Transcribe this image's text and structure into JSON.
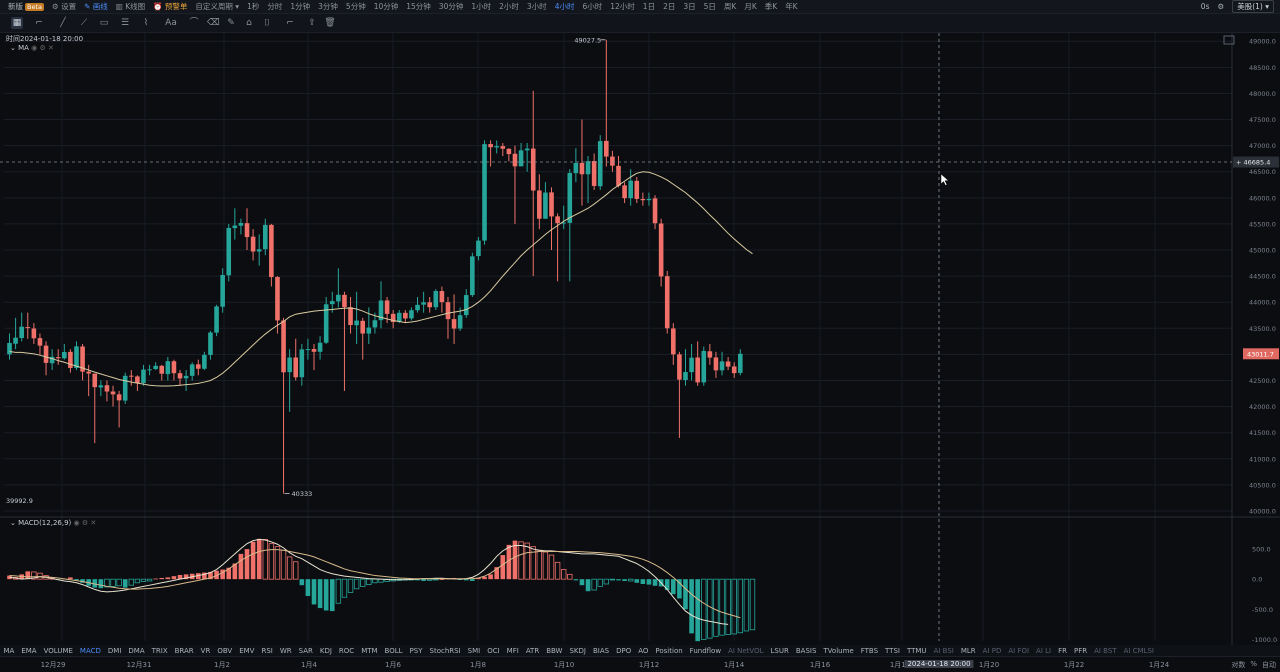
{
  "topbar": {
    "brand": "新版",
    "brand_badge": "Beta",
    "settings": "设置",
    "draw": "画线",
    "chart_type": "K线图",
    "alert": "预警单",
    "custom_period": "自定义周期",
    "periods": [
      "1秒",
      "分时",
      "1分钟",
      "3分钟",
      "5分钟",
      "10分钟",
      "15分钟",
      "30分钟",
      "1小时",
      "2小时",
      "3小时",
      "4小时",
      "6小时",
      "12小时",
      "1日",
      "2日",
      "3日",
      "5日",
      "周K",
      "月K",
      "季K",
      "年K"
    ],
    "active_period": "4小时",
    "right_text": "0s",
    "currency_select": "美股(1)"
  },
  "toolbar": {
    "tools": [
      "crosshair-icon",
      "line-icon",
      "ray-icon",
      "trend-icon",
      "rect-icon",
      "fib-icon",
      "brush-icon",
      "text-icon",
      "measure-icon",
      "erase-icon",
      "pencil-icon",
      "magnet-icon",
      "lock-icon",
      "eye-icon",
      "share-icon",
      "trash-icon"
    ]
  },
  "info": {
    "time_label": "时间2024-01-18 20:00",
    "ma_label": "MA",
    "macd_label": "MACD(12,26,9)"
  },
  "annotations": {
    "high": "49027.5",
    "low": "40333",
    "bottom_left": "39992.9",
    "crosshair_price": "46685.4",
    "last_price": "43011.7"
  },
  "colors": {
    "up": "#26a69a",
    "down": "#ef7169",
    "ma": "#d9cba0",
    "macd_line": "#e8e2cf",
    "signal_line": "#d8b98a",
    "last_price_bg": "#e06a62"
  },
  "chart_data": {
    "type": "candlestick",
    "interval": "4小时",
    "ylim": [
      40000,
      49100
    ],
    "y_ticks": [
      "49000.0",
      "48500.0",
      "48000.0",
      "47500.0",
      "47000.0",
      "46500.0",
      "46000.0",
      "45500.0",
      "45000.0",
      "44500.0",
      "44000.0",
      "43500.0",
      "43000.0",
      "42500.0",
      "42000.0",
      "41500.0",
      "41000.0",
      "40500.0",
      "40000.0"
    ],
    "x_ticks": [
      "12月29",
      "12月31",
      "1月2",
      "1月4",
      "1月6",
      "1月8",
      "1月10",
      "1月12",
      "1月14",
      "1月16",
      "1月18",
      "2024-01-18 20:00",
      "1月20",
      "1月22",
      "1月24"
    ],
    "candles": [
      [
        43001,
        43219,
        42900,
        43400
      ],
      [
        43204,
        43320,
        43100,
        43700
      ],
      [
        43314,
        43531,
        43250,
        43800
      ],
      [
        43524,
        43504,
        43300,
        43800
      ],
      [
        43496,
        43308,
        43200,
        43600
      ],
      [
        43312,
        43168,
        43000,
        43400
      ],
      [
        43168,
        42837,
        42600,
        43250
      ],
      [
        42831,
        42954,
        42700,
        43100
      ],
      [
        42948,
        42926,
        42800,
        43100
      ],
      [
        42926,
        43046,
        42900,
        43200
      ],
      [
        43049,
        42740,
        42650,
        43100
      ],
      [
        42740,
        43154,
        42700,
        43250
      ],
      [
        43152,
        42670,
        42500,
        43200
      ],
      [
        42671,
        42633,
        42200,
        42800
      ],
      [
        42633,
        42373,
        41300,
        42500
      ],
      [
        42367,
        42409,
        42200,
        42500
      ],
      [
        42409,
        42289,
        42100,
        42500
      ],
      [
        42289,
        42235,
        42000,
        42400
      ],
      [
        42235,
        42120,
        41600,
        42300
      ],
      [
        42115,
        42590,
        42050,
        42650
      ],
      [
        42592,
        42576,
        42400,
        42700
      ],
      [
        42578,
        42452,
        42300,
        42600
      ],
      [
        42452,
        42709,
        42400,
        42800
      ],
      [
        42709,
        42714,
        42600,
        42800
      ],
      [
        42720,
        42781,
        42700,
        42850
      ],
      [
        42781,
        42630,
        42500,
        42800
      ],
      [
        42623,
        42870,
        42500,
        42950
      ],
      [
        42870,
        42640,
        42500,
        42900
      ],
      [
        42640,
        42539,
        42400,
        42700
      ],
      [
        42541,
        42589,
        42300,
        42700
      ],
      [
        42589,
        42808,
        42500,
        42850
      ],
      [
        42810,
        42725,
        42600,
        42900
      ],
      [
        42725,
        42991,
        42700,
        43050
      ],
      [
        42990,
        43419,
        42900,
        43450
      ],
      [
        43417,
        43919,
        43350,
        43950
      ],
      [
        43913,
        44521,
        43800,
        44650
      ],
      [
        44516,
        45423,
        44400,
        45500
      ],
      [
        45419,
        45469,
        45200,
        45800
      ],
      [
        45465,
        45518,
        45300,
        45600
      ],
      [
        45514,
        45248,
        45000,
        45800
      ],
      [
        45256,
        44971,
        44800,
        45400
      ],
      [
        44971,
        45014,
        44700,
        45300
      ],
      [
        45017,
        45481,
        44900,
        45600
      ],
      [
        45482,
        44481,
        44300,
        45500
      ],
      [
        44483,
        43651,
        43400,
        44500
      ],
      [
        43650,
        42657,
        40333,
        43700
      ],
      [
        42660,
        42940,
        41900,
        43100
      ],
      [
        42941,
        42562,
        42500,
        43300
      ],
      [
        42563,
        43096,
        42400,
        43200
      ],
      [
        43092,
        43102,
        42900,
        43300
      ],
      [
        43103,
        43050,
        42700,
        43200
      ],
      [
        43050,
        43223,
        42900,
        43350
      ],
      [
        43224,
        43960,
        43200,
        44100
      ],
      [
        43963,
        44021,
        43800,
        44200
      ],
      [
        44016,
        44142,
        43900,
        44650
      ],
      [
        44141,
        43905,
        42300,
        44200
      ],
      [
        43905,
        43563,
        43400,
        44100
      ],
      [
        43559,
        43648,
        43200,
        44200
      ],
      [
        43643,
        43400,
        42900,
        43700
      ],
      [
        43399,
        43514,
        43200,
        43900
      ],
      [
        43517,
        43654,
        43400,
        43800
      ],
      [
        43656,
        44033,
        43500,
        44400
      ],
      [
        44034,
        43776,
        43600,
        44100
      ],
      [
        43777,
        43619,
        43500,
        43850
      ],
      [
        43622,
        43797,
        43600,
        43850
      ],
      [
        43797,
        43689,
        43600,
        43850
      ],
      [
        43690,
        43846,
        43650,
        43900
      ],
      [
        43846,
        43949,
        43800,
        44100
      ],
      [
        43953,
        43998,
        43800,
        44200
      ],
      [
        43998,
        43904,
        43800,
        44100
      ],
      [
        43904,
        44214,
        43850,
        44250
      ],
      [
        44214,
        44002,
        43800,
        44300
      ],
      [
        44000,
        43676,
        43300,
        44100
      ],
      [
        43676,
        43495,
        43200,
        44150
      ],
      [
        43495,
        43751,
        43450,
        43900
      ],
      [
        43753,
        44137,
        43700,
        44250
      ],
      [
        44137,
        44878,
        44100,
        44950
      ],
      [
        44883,
        45180,
        44800,
        45250
      ],
      [
        45180,
        47028,
        45100,
        47100
      ],
      [
        47030,
        46969,
        46600,
        47100
      ],
      [
        46965,
        46990,
        46850,
        47100
      ],
      [
        46990,
        46940,
        46800,
        47050
      ],
      [
        46939,
        46838,
        46700,
        46950
      ],
      [
        46844,
        46603,
        45500,
        47000
      ],
      [
        46603,
        46910,
        46700,
        47050
      ],
      [
        46909,
        46944,
        46500,
        47050
      ],
      [
        46944,
        46139,
        44500,
        48050
      ],
      [
        46141,
        45599,
        45400,
        46450
      ],
      [
        45599,
        46101,
        45600,
        46300
      ],
      [
        46104,
        45643,
        45000,
        46200
      ],
      [
        45645,
        45514,
        44400,
        45700
      ],
      [
        45508,
        45526,
        45400,
        45850
      ],
      [
        45520,
        46475,
        44400,
        46550
      ],
      [
        46472,
        46667,
        46300,
        46950
      ],
      [
        46667,
        46451,
        45850,
        47500
      ],
      [
        46451,
        46702,
        45900,
        46800
      ],
      [
        46705,
        46227,
        46150,
        46850
      ],
      [
        46222,
        47086,
        46150,
        47200
      ],
      [
        47090,
        46790,
        46600,
        49027.5
      ],
      [
        46790,
        46615,
        46500,
        46900
      ],
      [
        46612,
        46231,
        46200,
        46800
      ],
      [
        46239,
        45993,
        45900,
        46300
      ],
      [
        45993,
        46328,
        45850,
        46550
      ],
      [
        46325,
        45979,
        45900,
        46400
      ],
      [
        45978,
        45954,
        45850,
        46100
      ],
      [
        45955,
        45980,
        45850,
        46100
      ],
      [
        45990,
        45513,
        45400,
        46050
      ],
      [
        45508,
        44493,
        44300,
        45600
      ],
      [
        44499,
        43501,
        43400,
        44600
      ],
      [
        43497,
        43001,
        42800,
        43600
      ],
      [
        43001,
        42516,
        41400,
        43050
      ],
      [
        42509,
        42662,
        42400,
        43100
      ],
      [
        42661,
        42937,
        42500,
        43200
      ],
      [
        42941,
        42464,
        42400,
        43250
      ],
      [
        42464,
        43066,
        42400,
        43150
      ],
      [
        43060,
        42939,
        42800,
        43200
      ],
      [
        42942,
        42695,
        42550,
        43050
      ],
      [
        42695,
        42866,
        42600,
        43050
      ],
      [
        42864,
        42766,
        42700,
        42950
      ],
      [
        42770,
        42641,
        42550,
        42850
      ],
      [
        42646,
        43012,
        42600,
        43100
      ]
    ],
    "ma_values": [
      43055,
      43040,
      43040,
      43025,
      43010,
      42985,
      42950,
      42920,
      42880,
      42850,
      42810,
      42775,
      42740,
      42700,
      42660,
      42625,
      42590,
      42555,
      42520,
      42495,
      42470,
      42450,
      42430,
      42410,
      42400,
      42395,
      42395,
      42400,
      42410,
      42420,
      42430,
      42445,
      42470,
      42500,
      42560,
      42640,
      42740,
      42850,
      42960,
      43070,
      43180,
      43290,
      43390,
      43480,
      43560,
      43630,
      43720,
      43770,
      43790,
      43810,
      43830,
      43840,
      43850,
      43860,
      43875,
      43885,
      43890,
      43870,
      43830,
      43780,
      43740,
      43710,
      43680,
      43650,
      43630,
      43610,
      43620,
      43640,
      43670,
      43700,
      43730,
      43760,
      43790,
      43810,
      43830,
      43860,
      43920,
      44000,
      44100,
      44220,
      44360,
      44500,
      44630,
      44760,
      44890,
      45000,
      45100,
      45200,
      45300,
      45390,
      45470,
      45550,
      45620,
      45680,
      45740,
      45800,
      45880,
      45970,
      46060,
      46160,
      46240,
      46320,
      46400,
      46470,
      46500,
      46490,
      46450,
      46400,
      46340,
      46260,
      46180,
      46100,
      46000,
      45900,
      45790,
      45670,
      45560,
      45440,
      45320,
      45210,
      45110,
      45010,
      44930
    ],
    "macd": {
      "ylim": [
        -1060,
        800
      ],
      "y_ticks": [
        "500.0",
        "0.0",
        "-500.0",
        "-1000.0"
      ],
      "hist": [
        60,
        30,
        80,
        130,
        120,
        100,
        60,
        20,
        -10,
        10,
        30,
        -20,
        -60,
        -110,
        -140,
        -150,
        -130,
        -120,
        -110,
        -140,
        -100,
        -60,
        -40,
        -30,
        10,
        20,
        30,
        50,
        70,
        80,
        90,
        100,
        110,
        120,
        140,
        160,
        190,
        260,
        420,
        500,
        620,
        670,
        660,
        590,
        540,
        480,
        370,
        290,
        -100,
        -280,
        -420,
        -480,
        -520,
        -530,
        -400,
        -300,
        -220,
        -160,
        -120,
        -90,
        -60,
        -50,
        -40,
        -30,
        -20,
        -10,
        -10,
        -20,
        -30,
        -20,
        -10,
        0,
        10,
        20,
        -10,
        -20,
        -30,
        20,
        40,
        80,
        200,
        400,
        570,
        640,
        620,
        600,
        540,
        480,
        450,
        400,
        280,
        160,
        80,
        -20,
        -100,
        -200,
        -180,
        -120,
        -80,
        -10,
        -20,
        -30,
        -30,
        -60,
        -80,
        -90,
        -110,
        -120,
        -180,
        -250,
        -320,
        -500,
        -900,
        -1030,
        -1000,
        -980,
        -950,
        -930,
        -920,
        -910,
        -890,
        -860,
        -840
      ],
      "macd_line": [
        30,
        20,
        0,
        10,
        20,
        40,
        30,
        10,
        -10,
        -30,
        -40,
        -60,
        -90,
        -130,
        -170,
        -200,
        -210,
        -205,
        -195,
        -180,
        -160,
        -140,
        -120,
        -100,
        -80,
        -60,
        -40,
        -20,
        0,
        20,
        40,
        60,
        80,
        110,
        160,
        240,
        330,
        420,
        510,
        590,
        640,
        660,
        650,
        620,
        580,
        520,
        440,
        380,
        340,
        280,
        220,
        160,
        120,
        90,
        70,
        50,
        40,
        30,
        20,
        10,
        5,
        0,
        -5,
        -10,
        -10,
        -10,
        -5,
        0,
        10,
        10,
        15,
        15,
        10,
        5,
        0,
        10,
        30,
        80,
        160,
        260,
        380,
        470,
        530,
        560,
        560,
        540,
        500,
        480,
        470,
        470,
        460,
        450,
        440,
        430,
        420,
        420,
        420,
        410,
        400,
        390,
        380,
        340,
        300,
        260,
        200,
        130,
        40,
        -60,
        -170,
        -300,
        -420,
        -530,
        -600,
        -650,
        -680,
        -700,
        -720,
        -740,
        -750
      ],
      "signal_line": [
        60,
        55,
        45,
        40,
        40,
        45,
        40,
        30,
        20,
        5,
        -10,
        -25,
        -40,
        -60,
        -80,
        -100,
        -120,
        -135,
        -150,
        -160,
        -165,
        -165,
        -160,
        -155,
        -145,
        -135,
        -120,
        -100,
        -80,
        -60,
        -40,
        -20,
        0,
        20,
        60,
        110,
        170,
        240,
        310,
        370,
        420,
        460,
        480,
        490,
        490,
        480,
        460,
        440,
        420,
        400,
        370,
        330,
        290,
        250,
        210,
        170,
        140,
        120,
        100,
        80,
        60,
        50,
        40,
        30,
        20,
        15,
        10,
        8,
        6,
        6,
        8,
        8,
        8,
        8,
        6,
        6,
        10,
        20,
        50,
        100,
        170,
        240,
        310,
        370,
        410,
        440,
        450,
        460,
        460,
        460,
        460,
        460,
        460,
        460,
        455,
        450,
        445,
        440,
        430,
        420,
        410,
        395,
        380,
        360,
        330,
        290,
        240,
        180,
        110,
        30,
        -60,
        -160,
        -250,
        -330,
        -400,
        -460,
        -510,
        -550,
        -580,
        -610,
        -640
      ]
    }
  },
  "bottom_indicators": [
    "MA",
    "EMA",
    "VOLUME",
    "MACD",
    "DMI",
    "DMA",
    "TRIX",
    "BRAR",
    "VR",
    "OBV",
    "EMV",
    "RSI",
    "WR",
    "SAR",
    "KDJ",
    "ROC",
    "MTM",
    "BOLL",
    "PSY",
    "StochRSI",
    "SMI",
    "OCI",
    "MFI",
    "ATR",
    "BBW",
    "SKDJ",
    "BIAS",
    "DPO",
    "AO",
    "Position",
    "Fundflow",
    "AI NetVOL",
    "LSUR",
    "BASIS",
    "TVolume",
    "FTBS",
    "TTSI",
    "TTMU",
    "AI BSI",
    "MLR",
    "AI PD",
    "AI FOI",
    "AI LI",
    "FR",
    "PFR",
    "AI BST",
    "AI CMLSI"
  ],
  "active_indicator": "MACD",
  "scale_buttons": [
    "对数",
    "%",
    "自动"
  ]
}
